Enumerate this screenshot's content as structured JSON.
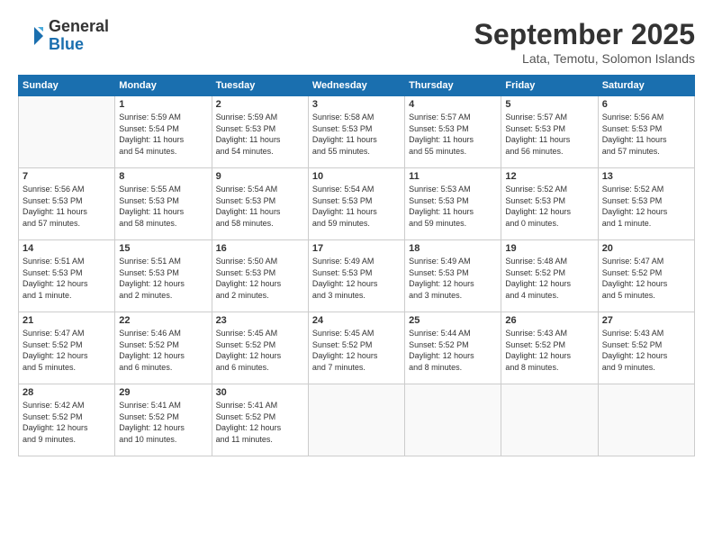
{
  "header": {
    "logo": {
      "general": "General",
      "blue": "Blue"
    },
    "title": "September 2025",
    "location": "Lata, Temotu, Solomon Islands"
  },
  "calendar": {
    "days_of_week": [
      "Sunday",
      "Monday",
      "Tuesday",
      "Wednesday",
      "Thursday",
      "Friday",
      "Saturday"
    ],
    "weeks": [
      [
        {
          "day": "",
          "info": ""
        },
        {
          "day": "1",
          "info": "Sunrise: 5:59 AM\nSunset: 5:54 PM\nDaylight: 11 hours\nand 54 minutes."
        },
        {
          "day": "2",
          "info": "Sunrise: 5:59 AM\nSunset: 5:53 PM\nDaylight: 11 hours\nand 54 minutes."
        },
        {
          "day": "3",
          "info": "Sunrise: 5:58 AM\nSunset: 5:53 PM\nDaylight: 11 hours\nand 55 minutes."
        },
        {
          "day": "4",
          "info": "Sunrise: 5:57 AM\nSunset: 5:53 PM\nDaylight: 11 hours\nand 55 minutes."
        },
        {
          "day": "5",
          "info": "Sunrise: 5:57 AM\nSunset: 5:53 PM\nDaylight: 11 hours\nand 56 minutes."
        },
        {
          "day": "6",
          "info": "Sunrise: 5:56 AM\nSunset: 5:53 PM\nDaylight: 11 hours\nand 57 minutes."
        }
      ],
      [
        {
          "day": "7",
          "info": "Sunrise: 5:56 AM\nSunset: 5:53 PM\nDaylight: 11 hours\nand 57 minutes."
        },
        {
          "day": "8",
          "info": "Sunrise: 5:55 AM\nSunset: 5:53 PM\nDaylight: 11 hours\nand 58 minutes."
        },
        {
          "day": "9",
          "info": "Sunrise: 5:54 AM\nSunset: 5:53 PM\nDaylight: 11 hours\nand 58 minutes."
        },
        {
          "day": "10",
          "info": "Sunrise: 5:54 AM\nSunset: 5:53 PM\nDaylight: 11 hours\nand 59 minutes."
        },
        {
          "day": "11",
          "info": "Sunrise: 5:53 AM\nSunset: 5:53 PM\nDaylight: 11 hours\nand 59 minutes."
        },
        {
          "day": "12",
          "info": "Sunrise: 5:52 AM\nSunset: 5:53 PM\nDaylight: 12 hours\nand 0 minutes."
        },
        {
          "day": "13",
          "info": "Sunrise: 5:52 AM\nSunset: 5:53 PM\nDaylight: 12 hours\nand 1 minute."
        }
      ],
      [
        {
          "day": "14",
          "info": "Sunrise: 5:51 AM\nSunset: 5:53 PM\nDaylight: 12 hours\nand 1 minute."
        },
        {
          "day": "15",
          "info": "Sunrise: 5:51 AM\nSunset: 5:53 PM\nDaylight: 12 hours\nand 2 minutes."
        },
        {
          "day": "16",
          "info": "Sunrise: 5:50 AM\nSunset: 5:53 PM\nDaylight: 12 hours\nand 2 minutes."
        },
        {
          "day": "17",
          "info": "Sunrise: 5:49 AM\nSunset: 5:53 PM\nDaylight: 12 hours\nand 3 minutes."
        },
        {
          "day": "18",
          "info": "Sunrise: 5:49 AM\nSunset: 5:53 PM\nDaylight: 12 hours\nand 3 minutes."
        },
        {
          "day": "19",
          "info": "Sunrise: 5:48 AM\nSunset: 5:52 PM\nDaylight: 12 hours\nand 4 minutes."
        },
        {
          "day": "20",
          "info": "Sunrise: 5:47 AM\nSunset: 5:52 PM\nDaylight: 12 hours\nand 5 minutes."
        }
      ],
      [
        {
          "day": "21",
          "info": "Sunrise: 5:47 AM\nSunset: 5:52 PM\nDaylight: 12 hours\nand 5 minutes."
        },
        {
          "day": "22",
          "info": "Sunrise: 5:46 AM\nSunset: 5:52 PM\nDaylight: 12 hours\nand 6 minutes."
        },
        {
          "day": "23",
          "info": "Sunrise: 5:45 AM\nSunset: 5:52 PM\nDaylight: 12 hours\nand 6 minutes."
        },
        {
          "day": "24",
          "info": "Sunrise: 5:45 AM\nSunset: 5:52 PM\nDaylight: 12 hours\nand 7 minutes."
        },
        {
          "day": "25",
          "info": "Sunrise: 5:44 AM\nSunset: 5:52 PM\nDaylight: 12 hours\nand 8 minutes."
        },
        {
          "day": "26",
          "info": "Sunrise: 5:43 AM\nSunset: 5:52 PM\nDaylight: 12 hours\nand 8 minutes."
        },
        {
          "day": "27",
          "info": "Sunrise: 5:43 AM\nSunset: 5:52 PM\nDaylight: 12 hours\nand 9 minutes."
        }
      ],
      [
        {
          "day": "28",
          "info": "Sunrise: 5:42 AM\nSunset: 5:52 PM\nDaylight: 12 hours\nand 9 minutes."
        },
        {
          "day": "29",
          "info": "Sunrise: 5:41 AM\nSunset: 5:52 PM\nDaylight: 12 hours\nand 10 minutes."
        },
        {
          "day": "30",
          "info": "Sunrise: 5:41 AM\nSunset: 5:52 PM\nDaylight: 12 hours\nand 11 minutes."
        },
        {
          "day": "",
          "info": ""
        },
        {
          "day": "",
          "info": ""
        },
        {
          "day": "",
          "info": ""
        },
        {
          "day": "",
          "info": ""
        }
      ]
    ]
  }
}
